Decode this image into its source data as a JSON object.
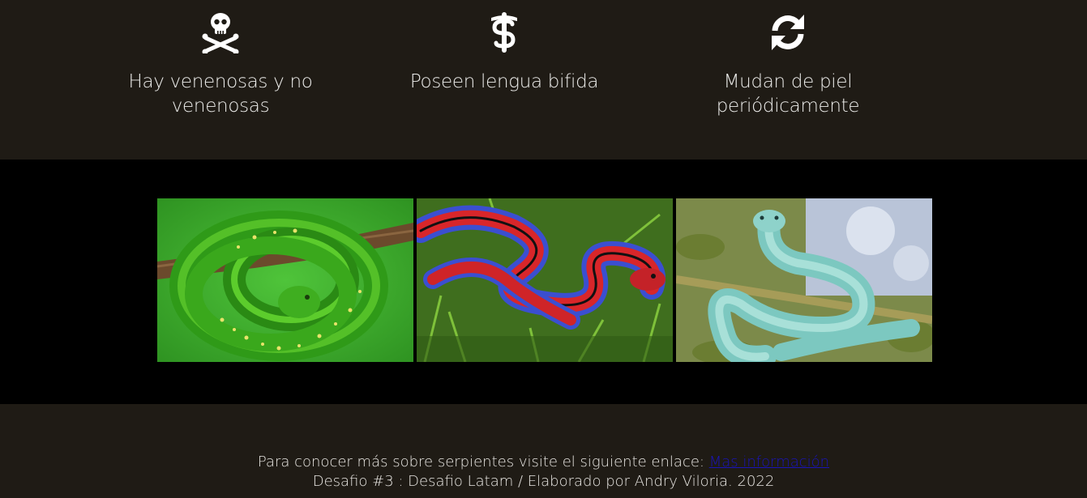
{
  "features": [
    {
      "icon": "skull-crossbones-icon",
      "text": "Hay venenosas y no venenosas"
    },
    {
      "icon": "medical-staff-icon",
      "text": "Poseen lengua bifida"
    },
    {
      "icon": "refresh-icon",
      "text": "Mudan de piel periódicamente"
    }
  ],
  "gallery": {
    "photos": [
      {
        "name": "green-tree-python-photo"
      },
      {
        "name": "red-blue-garter-snake-photo"
      },
      {
        "name": "blue-pit-viper-photo"
      }
    ]
  },
  "footer": {
    "intro_text": "Para conocer más sobre serpientes visite el siguiente enlace: ",
    "link_text": "Mas información",
    "credit_text": "Desafio #3 : Desafio Latam / Elaborado por Andry Viloria. 2022"
  },
  "colors": {
    "background": "#1f1b15",
    "gallery_background": "#000000",
    "text": "#e8e6e2",
    "link": "#1a14b8"
  }
}
